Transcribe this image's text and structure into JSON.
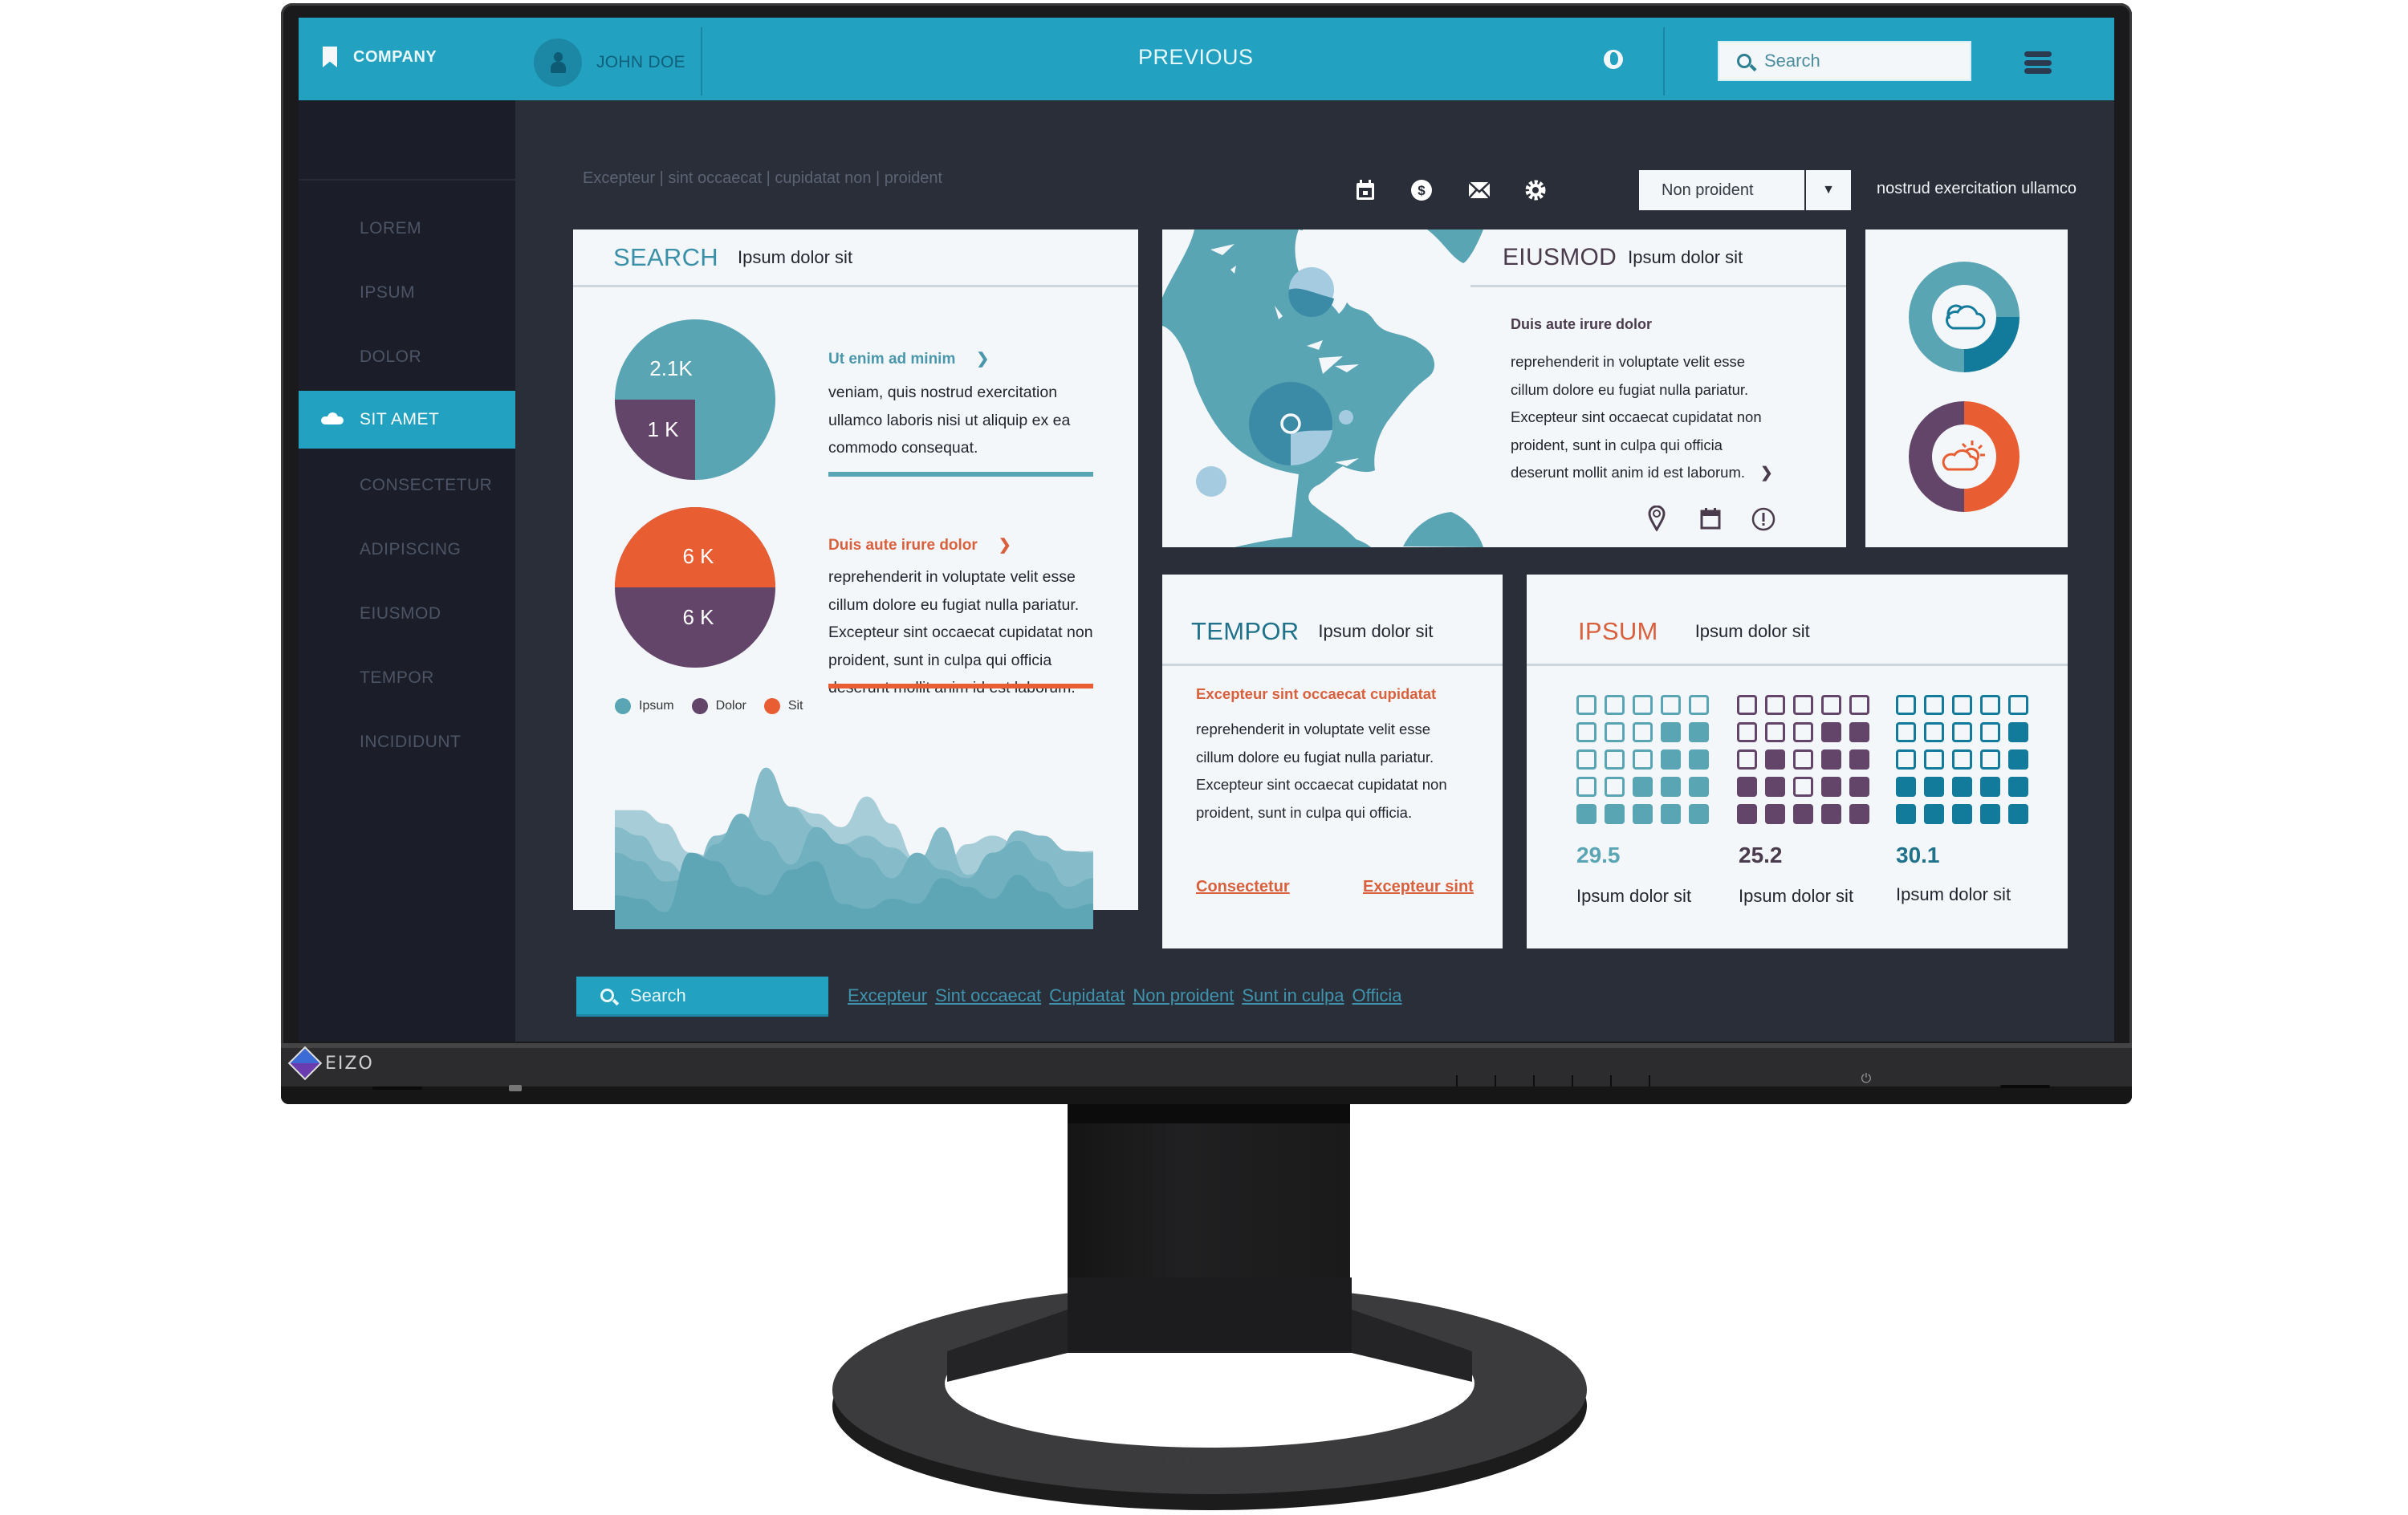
{
  "header": {
    "brand": "COMPANY",
    "user_name": "JOHN DOE",
    "center_label": "PREVIOUS",
    "search_placeholder": "Search",
    "icons": [
      "bookmark-icon",
      "user-icon",
      "globe-icon",
      "search-icon",
      "hamburger-menu-icon"
    ]
  },
  "sidebar": {
    "items": [
      {
        "label": "LOREM",
        "active": false
      },
      {
        "label": "IPSUM",
        "active": false
      },
      {
        "label": "DOLOR",
        "active": false
      },
      {
        "label": "SIT AMET",
        "active": true,
        "icon": "cloud-icon"
      },
      {
        "label": "CONSECTETUR",
        "active": false
      },
      {
        "label": "ADIPISCING",
        "active": false
      },
      {
        "label": "EIUSMOD",
        "active": false
      },
      {
        "label": "TEMPOR",
        "active": false
      },
      {
        "label": "INCIDIDUNT",
        "active": false
      }
    ]
  },
  "toolbar": {
    "breadcrumb": "Excepteur | sint occaecat | cupidatat non | proident",
    "icons": [
      "calendar-icon",
      "dollar-icon",
      "mail-icon",
      "gear-icon"
    ],
    "dropdown_value": "Non proident",
    "side_note": "nostrud exercitation ullamco"
  },
  "colors": {
    "accent": "#22a1c0",
    "teal": "#5aa5b4",
    "deep_teal": "#127b9b",
    "purple": "#634569",
    "orange": "#e85e32",
    "card_bg": "#f4f7f9",
    "screen_bg": "#2a2e38",
    "sidebar_bg": "#1b1e28"
  },
  "search_card": {
    "kicker": "SEARCH",
    "subtitle": "Ipsum dolor sit",
    "pie1": {
      "slices": [
        {
          "label": "2.1K",
          "series": "Ipsum",
          "value": 2.1
        },
        {
          "label": "1 K",
          "series": "Dolor",
          "value": 1
        }
      ]
    },
    "pie2": {
      "slices": [
        {
          "label": "6 K",
          "series": "Sit",
          "value": 6
        },
        {
          "label": "6 K",
          "series": "Dolor",
          "value": 6
        }
      ]
    },
    "legend": [
      "Ipsum",
      "Dolor",
      "Sit"
    ],
    "block1": {
      "heading": "Ut enim ad minim",
      "text": "veniam, quis nostrud exercitation ullamco laboris nisi ut aliquip ex ea commodo consequat."
    },
    "block2": {
      "heading": "Duis aute irure dolor",
      "text": "reprehenderit in voluptate velit esse cillum dolore eu fugiat nulla pariatur. Excepteur sint occaecat cupidatat non proident, sunt in culpa qui officia deserunt mollit anim id est laborum."
    },
    "area_series": [
      [
        70,
        70,
        62,
        45,
        42,
        55,
        58,
        72,
        68,
        60,
        78,
        62,
        40,
        35,
        50,
        55,
        50,
        48,
        45,
        46
      ],
      [
        60,
        55,
        40,
        30,
        55,
        60,
        95,
        72,
        60,
        50,
        55,
        48,
        40,
        60,
        32,
        40,
        58,
        55,
        46,
        45
      ],
      [
        45,
        40,
        28,
        30,
        50,
        68,
        52,
        38,
        60,
        50,
        42,
        30,
        45,
        35,
        30,
        45,
        52,
        40,
        25,
        30
      ],
      [
        20,
        18,
        10,
        45,
        40,
        25,
        20,
        35,
        40,
        15,
        12,
        18,
        15,
        30,
        25,
        18,
        32,
        22,
        12,
        15
      ]
    ]
  },
  "eiusmod_card": {
    "kicker": "EIUSMOD",
    "subtitle": "Ipsum dolor sit",
    "heading": "Duis aute irure dolor",
    "text": "reprehenderit in voluptate velit esse cillum dolore eu fugiat nulla pariatur. Excepteur sint occaecat cupidatat non proident, sunt in culpa qui officia deserunt mollit anim id est laborum.",
    "icons": [
      "map-pin-icon",
      "calendar-icon",
      "alert-icon"
    ]
  },
  "weather_card": {
    "donuts": [
      {
        "icon": "cloud-icon",
        "fraction": 0.25,
        "colors": [
          "#5aa5b4",
          "#127b9b"
        ]
      },
      {
        "icon": "partly-sunny-icon",
        "fraction": 0.5,
        "colors": [
          "#634569",
          "#e85e32"
        ]
      }
    ]
  },
  "tempor_card": {
    "kicker": "TEMPOR",
    "subtitle": "Ipsum dolor sit",
    "heading": "Excepteur sint occaecat cupidatat",
    "text": "reprehenderit in voluptate velit esse cillum dolore eu fugiat nulla pariatur. Excepteur sint occaecat cupidatat non proident, sunt in culpa qui officia.",
    "link1": "Consectetur",
    "link2": "Excepteur sint"
  },
  "ipsum_card": {
    "kicker": "IPSUM",
    "subtitle": "Ipsum dolor sit",
    "stats": [
      {
        "value": "29.5",
        "label": "Ipsum dolor sit",
        "color": "#5aa5b4",
        "grid": [
          [
            0,
            0,
            0,
            0,
            0
          ],
          [
            0,
            0,
            0,
            1,
            1
          ],
          [
            0,
            0,
            0,
            1,
            1
          ],
          [
            0,
            0,
            1,
            1,
            1
          ],
          [
            1,
            1,
            1,
            1,
            1
          ]
        ]
      },
      {
        "value": "25.2",
        "label": "Ipsum dolor sit",
        "color": "#634569",
        "grid": [
          [
            0,
            0,
            0,
            0,
            0
          ],
          [
            0,
            0,
            0,
            1,
            1
          ],
          [
            0,
            1,
            0,
            1,
            1
          ],
          [
            1,
            1,
            0,
            1,
            1
          ],
          [
            1,
            1,
            1,
            1,
            1
          ]
        ]
      },
      {
        "value": "30.1",
        "label": "Ipsum dolor sit",
        "color": "#127b9b",
        "grid": [
          [
            0,
            0,
            0,
            0,
            0
          ],
          [
            0,
            0,
            0,
            0,
            1
          ],
          [
            0,
            0,
            0,
            0,
            1
          ],
          [
            1,
            1,
            1,
            1,
            1
          ],
          [
            1,
            1,
            1,
            1,
            1
          ]
        ]
      }
    ]
  },
  "bottom_bar": {
    "search_label": "Search",
    "links": [
      "Excepteur",
      "Sint occaecat",
      "Cupidatat",
      "Non proident",
      "Sunt in culpa",
      "Officia"
    ]
  },
  "hardware": {
    "brand": "EIZO"
  }
}
